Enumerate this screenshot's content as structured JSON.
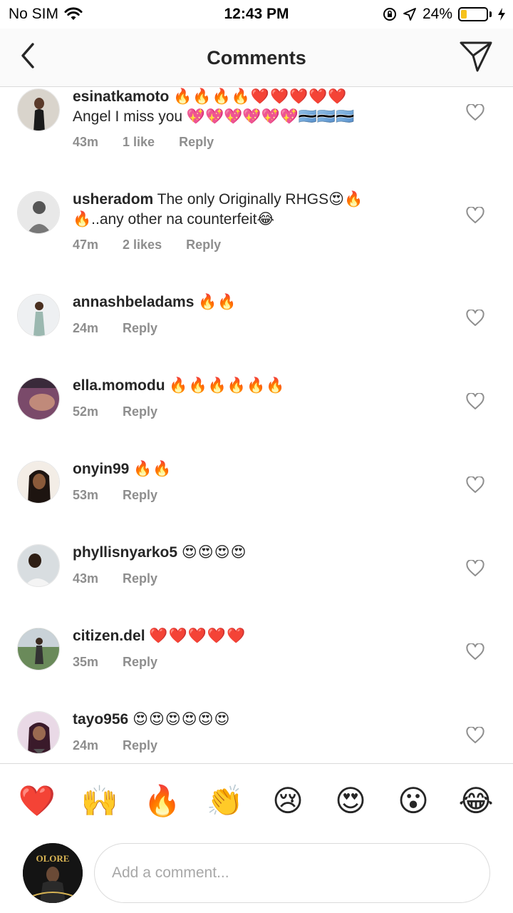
{
  "status_bar": {
    "carrier": "No SIM",
    "time": "12:43 PM",
    "battery_text": "24%",
    "battery_level": 0.24
  },
  "header": {
    "title": "Comments"
  },
  "comments": [
    {
      "user": "esinatkamoto",
      "text": "",
      "emoji_after_user": "🔥🔥🔥🔥❤️❤️❤️❤️❤️",
      "line2": "Angel I miss you 💖💖💖💖💖💖🇧🇼🇧🇼🇧🇼",
      "time": "43m",
      "likes": "1 like",
      "reply": "Reply"
    },
    {
      "user": "usheradom",
      "text": "The only Originally RHGS😍🔥",
      "emoji_after_user": "",
      "line2": "🔥..any other na counterfeit😂",
      "time": "47m",
      "likes": "2 likes",
      "reply": "Reply"
    },
    {
      "user": "annashbeladams",
      "text": "",
      "emoji_after_user": "🔥🔥",
      "line2": "",
      "time": "24m",
      "likes": "",
      "reply": "Reply"
    },
    {
      "user": "ella.momodu",
      "text": "",
      "emoji_after_user": "🔥🔥🔥🔥🔥🔥",
      "line2": "",
      "time": "52m",
      "likes": "",
      "reply": "Reply"
    },
    {
      "user": "onyin99",
      "text": "",
      "emoji_after_user": "🔥🔥",
      "line2": "",
      "time": "53m",
      "likes": "",
      "reply": "Reply"
    },
    {
      "user": "phyllisnyarko5",
      "text": "",
      "emoji_after_user": "😍😍😍😍",
      "line2": "",
      "time": "43m",
      "likes": "",
      "reply": "Reply"
    },
    {
      "user": "citizen.del",
      "text": "",
      "emoji_after_user": "❤️❤️❤️❤️❤️",
      "line2": "",
      "time": "35m",
      "likes": "",
      "reply": "Reply"
    },
    {
      "user": "tayo956",
      "text": "",
      "emoji_after_user": "😍😍😍😍😍😍",
      "line2": "",
      "time": "24m",
      "likes": "",
      "reply": "Reply"
    }
  ],
  "quick_emojis": [
    "❤️",
    "🙌",
    "🔥",
    "👏",
    "😢",
    "😍",
    "😮",
    "😂"
  ],
  "composer": {
    "placeholder": "Add a comment...",
    "avatar_text": "OLORE"
  }
}
